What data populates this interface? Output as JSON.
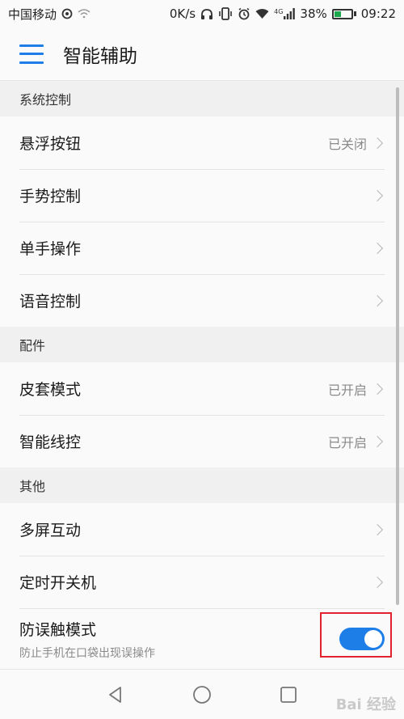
{
  "status_bar": {
    "carrier": "中国移动",
    "speed": "0K/s",
    "network": "4G",
    "battery": "38%",
    "battery_level": 0.38,
    "time": "09:22"
  },
  "header": {
    "title": "智能辅助"
  },
  "sections": [
    {
      "title": "系统控制"
    },
    {
      "title": "配件"
    },
    {
      "title": "其他"
    }
  ],
  "rows": {
    "floating_button": {
      "label": "悬浮按钮",
      "value": "已关闭"
    },
    "gesture_control": {
      "label": "手势控制"
    },
    "one_hand": {
      "label": "单手操作"
    },
    "voice_control": {
      "label": "语音控制"
    },
    "cover_mode": {
      "label": "皮套模式",
      "value": "已开启"
    },
    "smart_remote": {
      "label": "智能线控",
      "value": "已开启"
    },
    "multi_screen": {
      "label": "多屏互动"
    },
    "scheduled_power": {
      "label": "定时开关机"
    },
    "pocket_mode": {
      "label": "防误触模式",
      "sub": "防止手机在口袋出现误操作",
      "enabled": true
    }
  },
  "watermark": "Bai 经验",
  "colors": {
    "accent": "#1e7ee8",
    "highlight": "#e0232e",
    "battery": "#1aa84a"
  }
}
